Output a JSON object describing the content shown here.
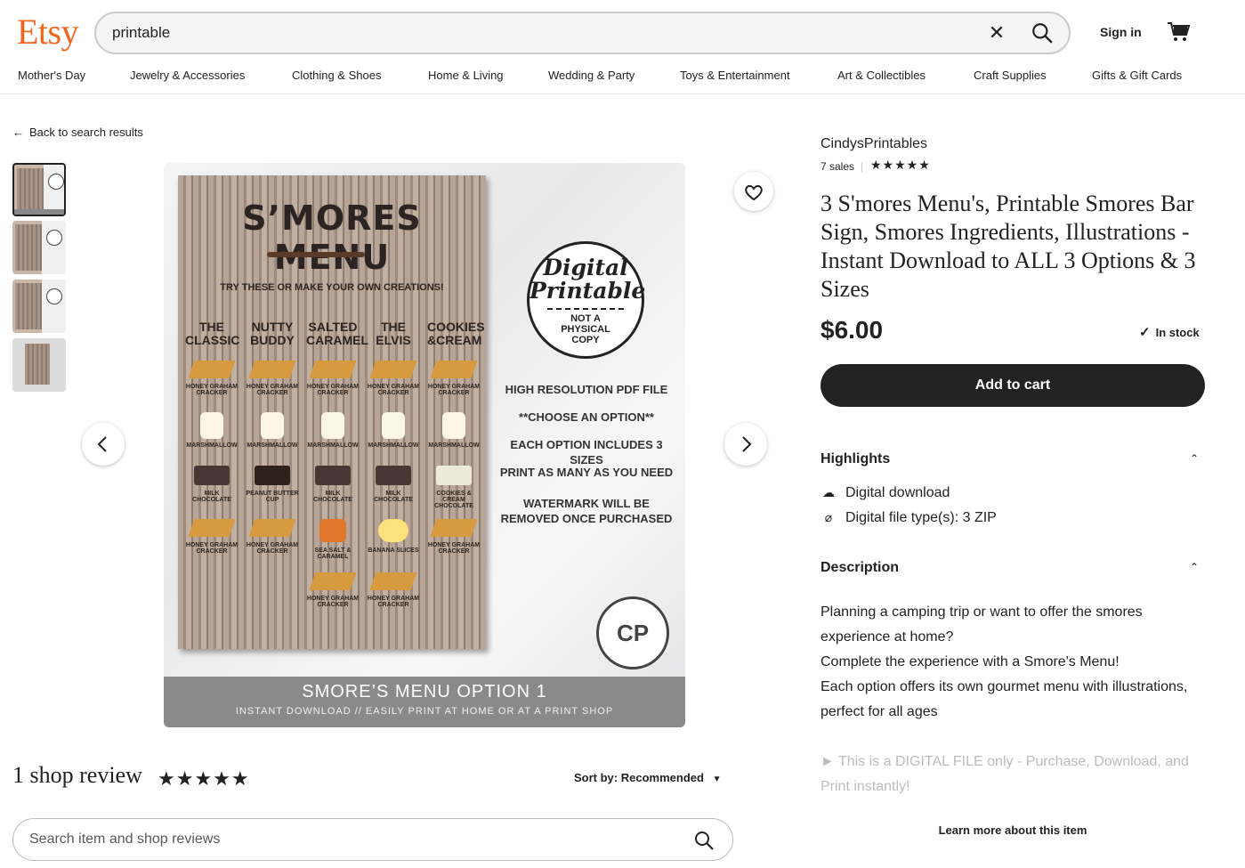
{
  "header": {
    "logo": "Etsy",
    "search_value": "printable",
    "sign_in": "Sign in",
    "nav": [
      "Mother's Day",
      "Jewelry & Accessories",
      "Clothing & Shoes",
      "Home & Living",
      "Wedding & Party",
      "Toys & Entertainment",
      "Art & Collectibles",
      "Craft Supplies",
      "Gifts & Gift Cards"
    ]
  },
  "back_link": "Back to search results",
  "image": {
    "title": "S’MORES MENU",
    "subtitle": "TRY THESE OR MAKE YOUR OWN CREATIONS!",
    "columns": [
      "THE CLASSIC",
      "NUTTY BUDDY",
      "SALTED CARAMEL",
      "THE ELVIS",
      "COOKIES &CREAM"
    ],
    "row1": [
      "HONEY GRAHAM CRACKER",
      "HONEY GRAHAM CRACKER",
      "HONEY GRAHAM CRACKER",
      "HONEY GRAHAM CRACKER",
      "HONEY GRAHAM CRACKER"
    ],
    "row2": [
      "MARSHMALLOW",
      "MARSHMALLOW",
      "MARSHMALLOW",
      "MARSHMALLOW",
      "MARSHMALLOW"
    ],
    "row3": [
      "MILK CHOCOLATE",
      "PEANUT BUTTER CUP",
      "MILK CHOCOLATE",
      "MILK CHOCOLATE",
      "COOKIES & CREAM CHOCOLATE"
    ],
    "row4": [
      "HONEY GRAHAM CRACKER",
      "HONEY GRAHAM CRACKER",
      "SEA SALT & CARAMEL",
      "BANANA SLICES",
      "HONEY GRAHAM CRACKER"
    ],
    "row5": [
      "HONEY GRAHAM CRACKER",
      "HONEY GRAHAM CRACKER"
    ],
    "badge_line1": "Digital",
    "badge_line2": "Printable",
    "badge_line3": "NOT A PHYSICAL COPY",
    "info": [
      "HIGH RESOLUTION PDF FILE",
      "**CHOOSE AN OPTION**",
      "EACH OPTION INCLUDES 3 SIZES",
      "PRINT AS MANY AS YOU NEED",
      "WATERMARK WILL BE REMOVED ONCE PURCHASED"
    ],
    "logo_text": "CP",
    "bar_title": "SMORE’S MENU OPTION 1",
    "bar_sub": "INSTANT DOWNLOAD // EASILY PRINT AT HOME OR AT A PRINT SHOP"
  },
  "reviews": {
    "title": "1 shop review",
    "stars": "★★★★★",
    "sort_label": "Sort by:",
    "sort_value": "Recommended",
    "search_placeholder": "Search item and shop reviews"
  },
  "product": {
    "shop_name": "CindysPrintables",
    "sales": "7 sales",
    "stars": "★★★★★",
    "title": "3 S'mores Menu's, Printable Smores Bar Sign, Smores Ingredients, Illustrations - Instant Download to ALL 3 Options & 3 Sizes",
    "price": "$6.00",
    "stock": "In stock",
    "add_to_cart": "Add to cart",
    "highlights_label": "Highlights",
    "highlight1": "Digital download",
    "highlight2": "Digital file type(s): 3 ZIP",
    "description_label": "Description",
    "desc1": "Planning a camping trip or want to offer the smores experience at home?",
    "desc2": "Complete the experience with a Smore's Menu!",
    "desc3": "Each option offers its own gourmet menu with illustrations, perfect for all ages",
    "desc4": "► This is a DIGITAL FILE only - Purchase, Download, and Print instantly!",
    "learn_more": "Learn more about this item"
  },
  "colors": {
    "brand": "#f1641e",
    "button": "#222222"
  }
}
